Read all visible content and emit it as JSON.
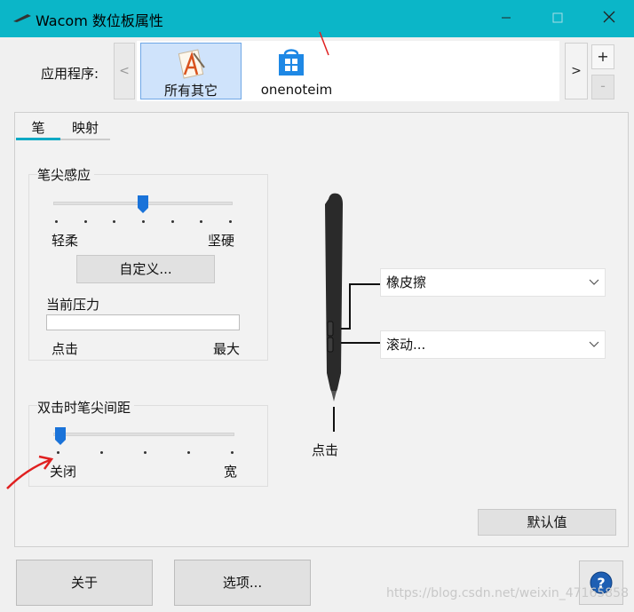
{
  "window": {
    "title": "Wacom 数位板属性",
    "title_color": "#0bb6c8"
  },
  "apps": {
    "label": "应用程序:",
    "prev": "<",
    "next": ">",
    "add": "+",
    "remove": "-",
    "tiles": [
      {
        "label": "所有其它",
        "icon": "all-apps-icon",
        "selected": true
      },
      {
        "label": "onenoteim",
        "icon": "windows-store-icon",
        "selected": false
      }
    ]
  },
  "tabs": [
    {
      "label": "笔",
      "active": true
    },
    {
      "label": "映射",
      "active": false
    }
  ],
  "tip_feel": {
    "title": "笔尖感应",
    "level": 0.5,
    "soft_label": "轻柔",
    "firm_label": "坚硬",
    "customize": "自定义...",
    "pressure_label": "当前压力",
    "pressure_value": 0,
    "click_label": "点击",
    "max_label": "最大"
  },
  "double_click": {
    "title": "双击时笔尖间距",
    "level": 0.0,
    "off_label": "关闭",
    "wide_label": "宽"
  },
  "pen": {
    "tip_label": "点击",
    "upper_button": "橡皮擦",
    "lower_button": "滚动..."
  },
  "buttons": {
    "default": "默认值",
    "about": "关于",
    "options": "选项..."
  },
  "watermark": "https://blog.csdn.net/weixin_47165858",
  "colors": {
    "accent": "#0aa9c4",
    "slider_thumb": "#1a73d9",
    "selected_tile": "#cfe3fb",
    "annotation": "#e02020"
  }
}
